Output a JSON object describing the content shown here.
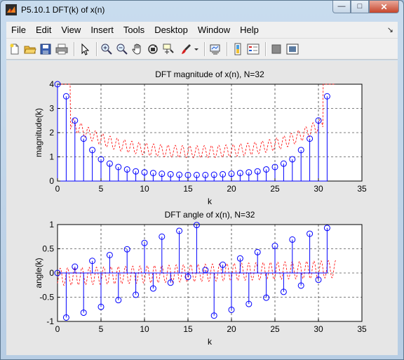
{
  "window": {
    "title": "P5.10.1 DFT(k) of x(n)",
    "controls": {
      "minimize": "—",
      "maximize": "□",
      "close": "✕"
    }
  },
  "menu": {
    "items": [
      "File",
      "Edit",
      "View",
      "Insert",
      "Tools",
      "Desktop",
      "Window",
      "Help"
    ],
    "dock_arrow": "↘"
  },
  "toolbar": {
    "buttons": [
      "new-figure-icon",
      "open-icon",
      "save-icon",
      "print-icon",
      "arrow-pointer-icon",
      "zoom-in-icon",
      "zoom-out-icon",
      "pan-hand-icon",
      "rotate-3d-icon",
      "data-cursor-icon",
      "brush-icon",
      "brush-dropdown-icon",
      "link-plot-icon",
      "colorbar-icon",
      "legend-icon",
      "hide-plot-tools-icon",
      "show-plot-tools-icon"
    ]
  },
  "chart_data": [
    {
      "type": "stem",
      "title": "DFT magnitude of x(n), N=32",
      "xlabel": "k",
      "ylabel": "magnitude(k)",
      "xlim": [
        0,
        35
      ],
      "ylim": [
        0,
        4
      ],
      "xticks": [
        "0",
        "5",
        "10",
        "15",
        "20",
        "25",
        "30",
        "35"
      ],
      "yticks": [
        "0",
        "1",
        "2",
        "3",
        "4"
      ],
      "grid": true,
      "series": [
        {
          "style": "stem-circle",
          "color": "#0000ff",
          "x": [
            0,
            1,
            2,
            3,
            4,
            5,
            6,
            7,
            8,
            9,
            10,
            11,
            12,
            13,
            14,
            15,
            16,
            17,
            18,
            19,
            20,
            21,
            22,
            23,
            24,
            25,
            26,
            27,
            28,
            29,
            30,
            31
          ],
          "values": [
            4.0,
            3.5,
            2.5,
            1.75,
            1.28,
            0.9,
            0.72,
            0.58,
            0.48,
            0.4,
            0.36,
            0.33,
            0.3,
            0.28,
            0.26,
            0.25,
            0.25,
            0.25,
            0.26,
            0.28,
            0.3,
            0.33,
            0.36,
            0.4,
            0.48,
            0.58,
            0.72,
            0.9,
            1.28,
            1.75,
            2.5,
            3.5
          ]
        },
        {
          "style": "dashed-line",
          "color": "#ff0000",
          "description_shown": "continuous DTFT magnitude (dashed)"
        }
      ]
    },
    {
      "type": "stem",
      "title": "DFT angle of x(n), N=32",
      "xlabel": "k",
      "ylabel": "angle(k)",
      "xlim": [
        0,
        35
      ],
      "ylim": [
        -1,
        1
      ],
      "xticks": [
        "0",
        "5",
        "10",
        "15",
        "20",
        "25",
        "30",
        "35"
      ],
      "yticks": [
        "-1",
        "-0.5",
        "0",
        "0.5",
        "1"
      ],
      "grid": true,
      "series": [
        {
          "style": "stem-circle",
          "color": "#0000ff",
          "x": [
            0,
            1,
            2,
            3,
            4,
            5,
            6,
            7,
            8,
            9,
            10,
            11,
            12,
            13,
            14,
            15,
            16,
            17,
            18,
            19,
            20,
            21,
            22,
            23,
            24,
            25,
            26,
            27,
            28,
            29,
            30,
            31
          ],
          "values": [
            0.0,
            -0.92,
            0.13,
            -0.82,
            0.25,
            -0.7,
            0.37,
            -0.56,
            0.49,
            -0.45,
            0.62,
            -0.32,
            0.75,
            -0.2,
            0.87,
            -0.08,
            0.99,
            0.06,
            -0.88,
            0.17,
            -0.76,
            0.3,
            -0.64,
            0.43,
            -0.51,
            0.56,
            -0.39,
            0.69,
            -0.26,
            0.81,
            -0.14,
            0.93
          ]
        },
        {
          "style": "dashed-line",
          "color": "#ff0000"
        }
      ]
    }
  ]
}
